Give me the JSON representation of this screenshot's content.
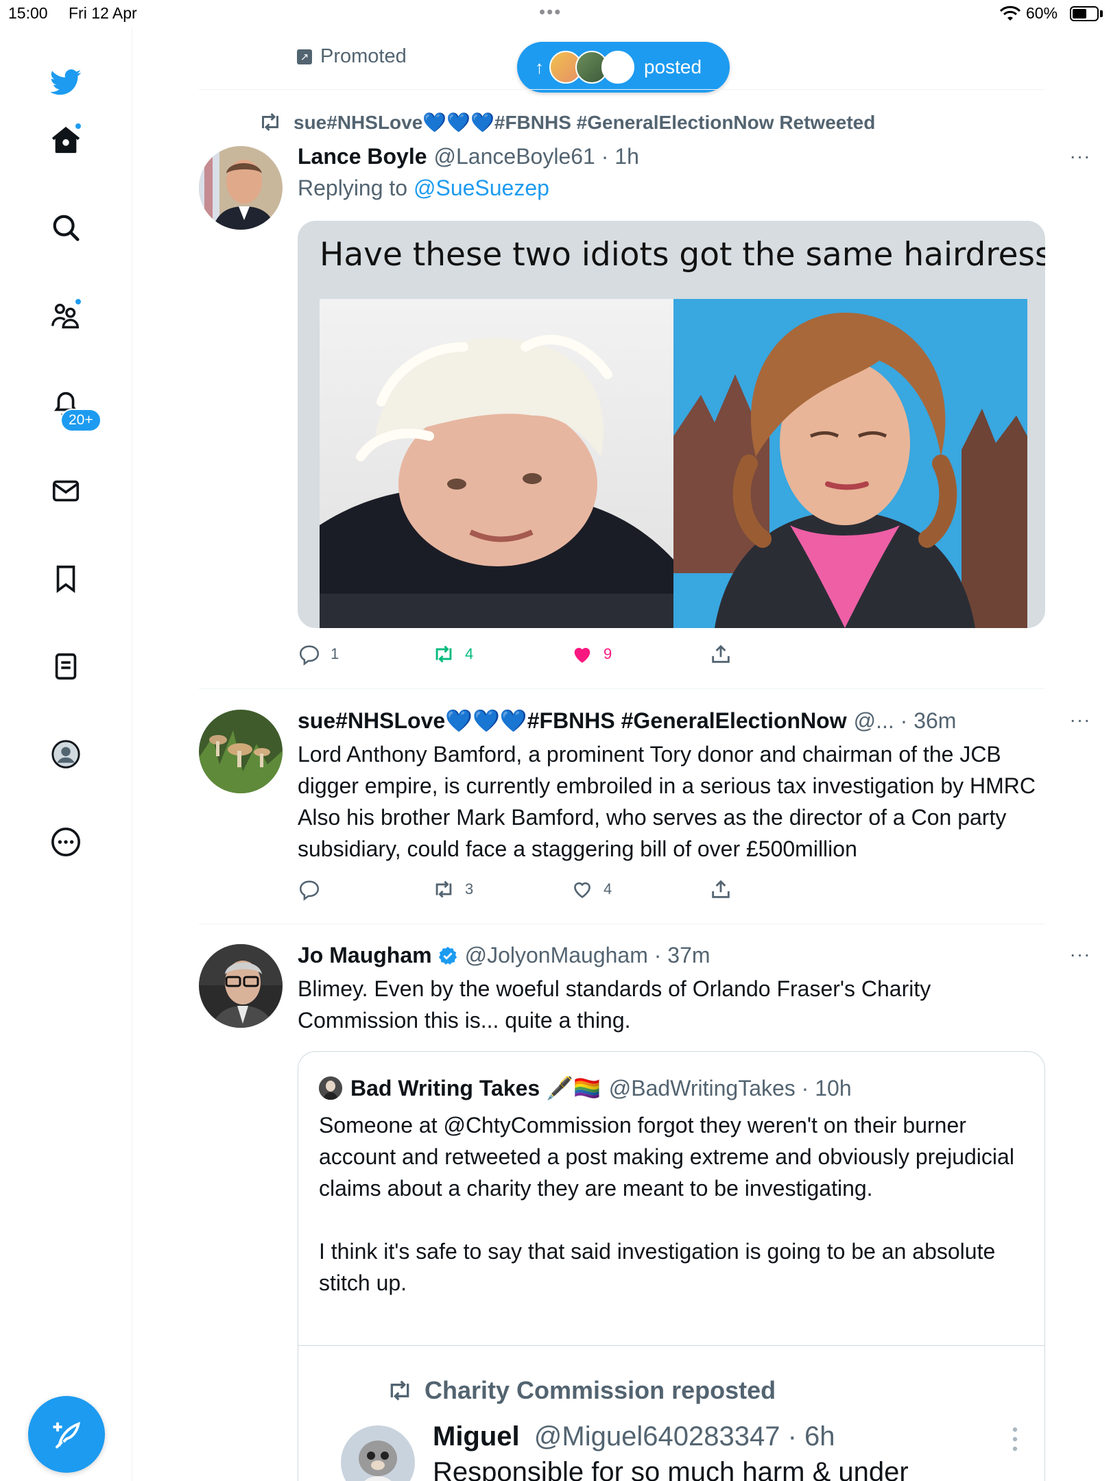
{
  "status": {
    "time": "15:00",
    "date": "Fri 12 Apr",
    "battery": "60%",
    "battery_level": 0.6
  },
  "sidebar": {
    "notifications_badge": "20+"
  },
  "promoted_label": "Promoted",
  "new_posts_pill": {
    "label": "posted"
  },
  "tweets": [
    {
      "retweet_by": "sue#NHSLove💙💙💙#FBNHS #GeneralElectionNow Retweeted",
      "name": "Lance Boyle",
      "handle": "@LanceBoyle61 · 1h",
      "replying_prefix": "Replying to",
      "replying_to": "@SueSuezep",
      "media_caption": "Have these two idiots got the same hairdresser",
      "replies": "1",
      "retweets": "4",
      "likes": "9"
    },
    {
      "name": "sue#NHSLove💙💙💙#FBNHS #GeneralElectionNow",
      "handle": "@... · 36m",
      "text": "Lord Anthony Bamford, a prominent Tory donor and chairman of the JCB digger empire, is currently embroiled in a serious tax investigation by HMRC Also his brother Mark Bamford, who serves as the director of a Con party subsidiary, could face a staggering bill of over £500million",
      "replies": "",
      "retweets": "3",
      "likes": "4"
    },
    {
      "name": "Jo Maugham",
      "handle": "@JolyonMaugham · 37m",
      "text": "Blimey. Even by the woeful standards of Orlando Fraser's Charity Commission this is... quite a thing.",
      "quote": {
        "name": "Bad Writing Takes 🖋️🏳️‍🌈",
        "handle": "@BadWritingTakes · 10h",
        "text_1": "Someone at @ChtyCommission forgot they weren't on their burner account and retweeted a post making extreme and obviously prejudicial claims about a charity they are meant to be investigating.",
        "text_2": "I think it's safe to say that said investigation is going to be an absolute stitch up.",
        "inner": {
          "retweet_by": "Charity Commission reposted",
          "name": "Miguel",
          "handle": "@Miguel640283347 · 6h",
          "text": "Responsible for so much harm & under"
        }
      }
    }
  ]
}
